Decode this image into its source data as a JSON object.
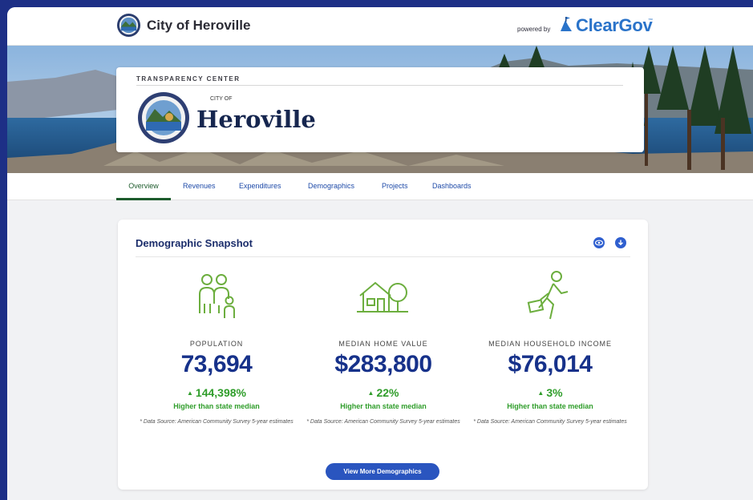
{
  "header": {
    "city_name": "City of Heroville",
    "powered_by": "powered by",
    "brand": "ClearGov",
    "brand_mark": "™"
  },
  "hero": {
    "kicker": "TRANSPARENCY CENTER",
    "small": "CITY OF",
    "big": "Heroville"
  },
  "tabs": [
    {
      "label": "Overview",
      "active": true
    },
    {
      "label": "Revenues"
    },
    {
      "label": "Expenditures"
    },
    {
      "label": "Demographics"
    },
    {
      "label": "Projects"
    },
    {
      "label": "Dashboards"
    }
  ],
  "snapshot": {
    "title": "Demographic Snapshot",
    "view_icon": "eye-icon",
    "download_icon": "download-icon",
    "stats": [
      {
        "label": "POPULATION",
        "value": "73,694",
        "change": "144,398%",
        "change_text": "Higher than state median",
        "source": "* Data Source: American Community Survey 5-year estimates",
        "icon": "family-icon"
      },
      {
        "label": "MEDIAN HOME VALUE",
        "value": "$283,800",
        "change": "22%",
        "change_text": "Higher than state median",
        "source": "* Data Source: American Community Survey 5-year estimates",
        "icon": "house-icon"
      },
      {
        "label": "MEDIAN HOUSEHOLD INCOME",
        "value": "$76,014",
        "change": "3%",
        "change_text": "Higher than state median",
        "source": "* Data Source: American Community Survey 5-year estimates",
        "icon": "worker-icon"
      }
    ],
    "button": "View More Demographics"
  },
  "colors": {
    "accent_blue": "#2a55bf",
    "positive_green": "#2f9d2a",
    "value_navy": "#16318a",
    "background_outer": "#1d2f86"
  }
}
